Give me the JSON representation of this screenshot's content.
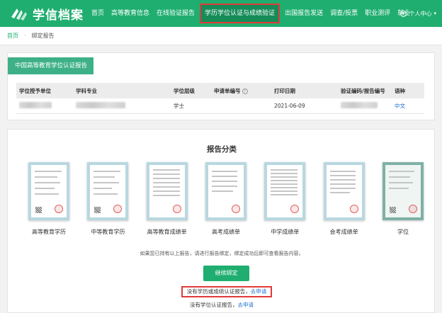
{
  "header": {
    "logo_text": "学信档案",
    "nav": [
      "首页",
      "高等教育信息",
      "在线验证报告",
      "学历学位认证与成绩验证",
      "出国报告发送",
      "调查/投票",
      "职业测评",
      "就业"
    ],
    "active_nav_index": 3,
    "user_menu": "个人中心",
    "brand_color": "#1fae6f",
    "highlight_color": "#e03a3a"
  },
  "breadcrumb": {
    "home": "首页",
    "current": "绑定报告"
  },
  "report": {
    "title": "中国高等教育学位认证报告",
    "columns": [
      "学位授予单位",
      "学科专业",
      "学位层级",
      "申请单编号",
      "打印日期",
      "验证编码/报告编号",
      "语种"
    ],
    "row": {
      "institution": "",
      "major": "",
      "level": "学士",
      "application_no": "",
      "print_date": "2021-06-09",
      "verify_code": "",
      "language": "中文"
    }
  },
  "classification": {
    "title": "报告分类",
    "items": [
      {
        "label": "高等教育学历",
        "icon": "certificate-image"
      },
      {
        "label": "中等教育学历",
        "icon": "certificate-image"
      },
      {
        "label": "高等教育成绩单",
        "icon": "transcript-image"
      },
      {
        "label": "高考成绩单",
        "icon": "transcript-image"
      },
      {
        "label": "中学成绩单",
        "icon": "transcript-image"
      },
      {
        "label": "会考成绩单",
        "icon": "transcript-image"
      },
      {
        "label": "学位",
        "icon": "degree-certificate-image"
      }
    ],
    "hint": "如果您已持有以上报告，请进行报告绑定，绑定成功后即可查看报告内容。",
    "continue_button": "继续绑定",
    "apply_education": {
      "text": "没有学历或成绩认证报告，",
      "link": "去申请"
    },
    "apply_degree": {
      "text": "没有学位认证报告，",
      "link": "去申请"
    }
  }
}
